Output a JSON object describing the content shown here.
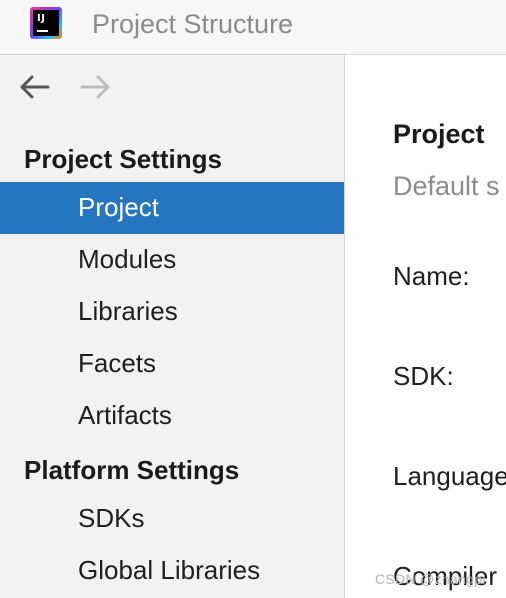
{
  "window": {
    "title": "Project Structure",
    "app_icon_text": "IJ"
  },
  "sidebar": {
    "back_icon": "arrow-left-icon",
    "forward_icon": "arrow-right-icon",
    "sections": [
      {
        "header": "Project Settings",
        "items": [
          {
            "label": "Project",
            "selected": true
          },
          {
            "label": "Modules",
            "selected": false
          },
          {
            "label": "Libraries",
            "selected": false
          },
          {
            "label": "Facets",
            "selected": false
          },
          {
            "label": "Artifacts",
            "selected": false
          }
        ]
      },
      {
        "header": "Platform Settings",
        "items": [
          {
            "label": "SDKs",
            "selected": false
          },
          {
            "label": "Global Libraries",
            "selected": false
          }
        ]
      }
    ]
  },
  "content": {
    "title": "Project",
    "subtitle": "Default s",
    "fields": [
      "Name:",
      "SDK:",
      "Language",
      "Compiler"
    ]
  },
  "watermark": "CSDN @zhangpi",
  "colors": {
    "selection": "#2675bf",
    "sidebar_bg": "#f2f2f2",
    "content_bg": "#ffffff",
    "muted_text": "#8c8c8c"
  }
}
